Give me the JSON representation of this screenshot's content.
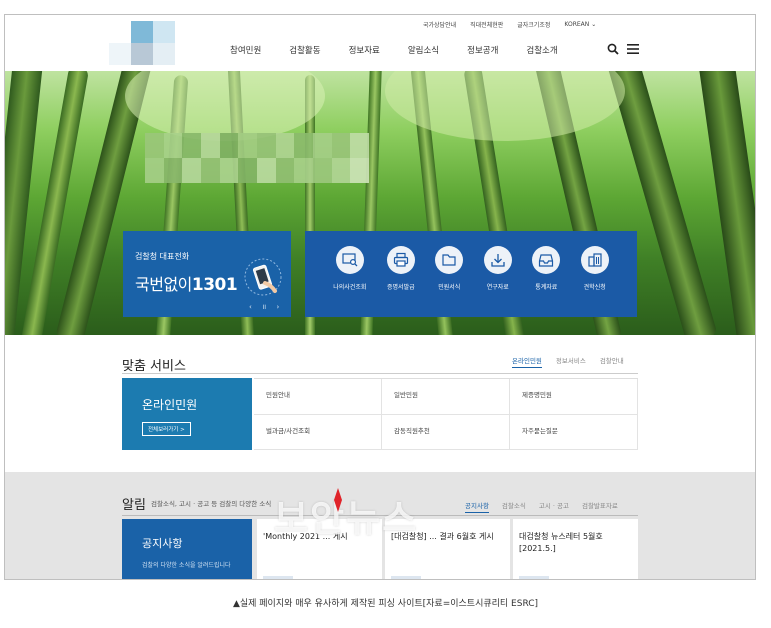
{
  "header": {
    "util_links": [
      "국가상담안내",
      "직대전체현판",
      "글자크기조정"
    ],
    "lang": "KOREAN",
    "nav": [
      "참여민원",
      "검찰활동",
      "정보자료",
      "알림소식",
      "정보공개",
      "검찰소개"
    ]
  },
  "hero": {
    "call_label": "검찰청 대표전화",
    "call_text": "국번없이",
    "call_number": "1301",
    "controls": "‹ ॥ ›",
    "quick": [
      {
        "icon": "search-monitor-icon",
        "label": "나의사건조회"
      },
      {
        "icon": "printer-icon",
        "label": "증명서발급"
      },
      {
        "icon": "folder-icon",
        "label": "민원서식"
      },
      {
        "icon": "download-icon",
        "label": "연구자료"
      },
      {
        "icon": "inbox-icon",
        "label": "통계자료"
      },
      {
        "icon": "building-icon",
        "label": "견학신청"
      }
    ]
  },
  "service": {
    "title": "맞춤 서비스",
    "tabs": [
      "온라인민원",
      "정보서비스",
      "검찰안내"
    ],
    "online_title": "온라인민원",
    "online_button": "전체보러가기 >",
    "cells": [
      "민원안내",
      "일반민원",
      "제증명민원",
      "벌과금/사건조회",
      "감동직원추천",
      "자주묻는질문"
    ]
  },
  "notice": {
    "title": "알림",
    "subtitle": "검찰소식, 고시 · 공고 등 검찰의 다양한 소식",
    "tabs": [
      "공지사항",
      "검찰소식",
      "고시 · 공고",
      "검찰발표자료"
    ],
    "box_title": "공지사항",
    "box_sub": "검찰의 다양한 소식을 알려드립니다",
    "cards": [
      "'Monthly 2021 ... 게시",
      "[대검찰청] ... 결과 6월호 게시",
      "대검찰청 뉴스레터 5월호[2021.5.]"
    ]
  },
  "watermark": "보안뉴스",
  "caption": "▲실제 페이지와 매우 유사하게 제작된 피싱 사이트[자료=이스트시큐리티 ESRC]"
}
